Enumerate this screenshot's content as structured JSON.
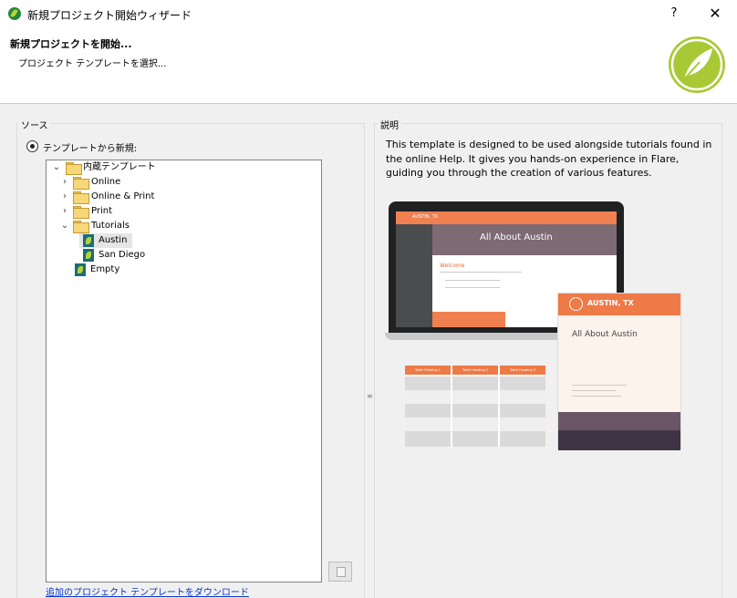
{
  "window": {
    "title": "新規プロジェクト開始ウィザード",
    "help_label": "?",
    "close_label": "✕"
  },
  "header": {
    "heading": "新規プロジェクトを開始...",
    "subheading": "プロジェクト テンプレートを選択..."
  },
  "source": {
    "label": "ソース",
    "radio_label": "テンプレートから新規:",
    "tree": [
      {
        "label": "内蔵テンプレート",
        "expanded": true,
        "icon": "folder-icon"
      },
      {
        "label": "Online",
        "expanded": false,
        "icon": "folder-icon"
      },
      {
        "label": "Online & Print",
        "expanded": false,
        "icon": "folder-icon"
      },
      {
        "label": "Print",
        "expanded": false,
        "icon": "folder-icon"
      },
      {
        "label": "Tutorials",
        "expanded": true,
        "icon": "folder-icon"
      },
      {
        "label": "Austin",
        "selected": true,
        "icon": "template-icon"
      },
      {
        "label": "San Diego",
        "icon": "template-icon"
      },
      {
        "label": "Empty",
        "icon": "template-icon"
      }
    ],
    "download_link": "追加のプロジェクト テンプレートをダウンロード"
  },
  "description": {
    "label": "説明",
    "text": "This template is designed to be used alongside tutorials found in the online Help. It gives you hands-on experience in Flare, guiding you through the creation of various features.",
    "preview": {
      "laptop_brand": "AUSTIN, TX",
      "laptop_banner": "All About Austin",
      "laptop_welcome": "Welcome",
      "card_brand": "AUSTIN, TX",
      "card_title": "All About Austin",
      "table_headers": [
        "Table Heading 1",
        "Table Heading 2",
        "Table Heading 3"
      ]
    }
  },
  "colors": {
    "accent_orange": "#ee7a47",
    "logo_green": "#a8c935",
    "link_blue": "#0033cc"
  }
}
